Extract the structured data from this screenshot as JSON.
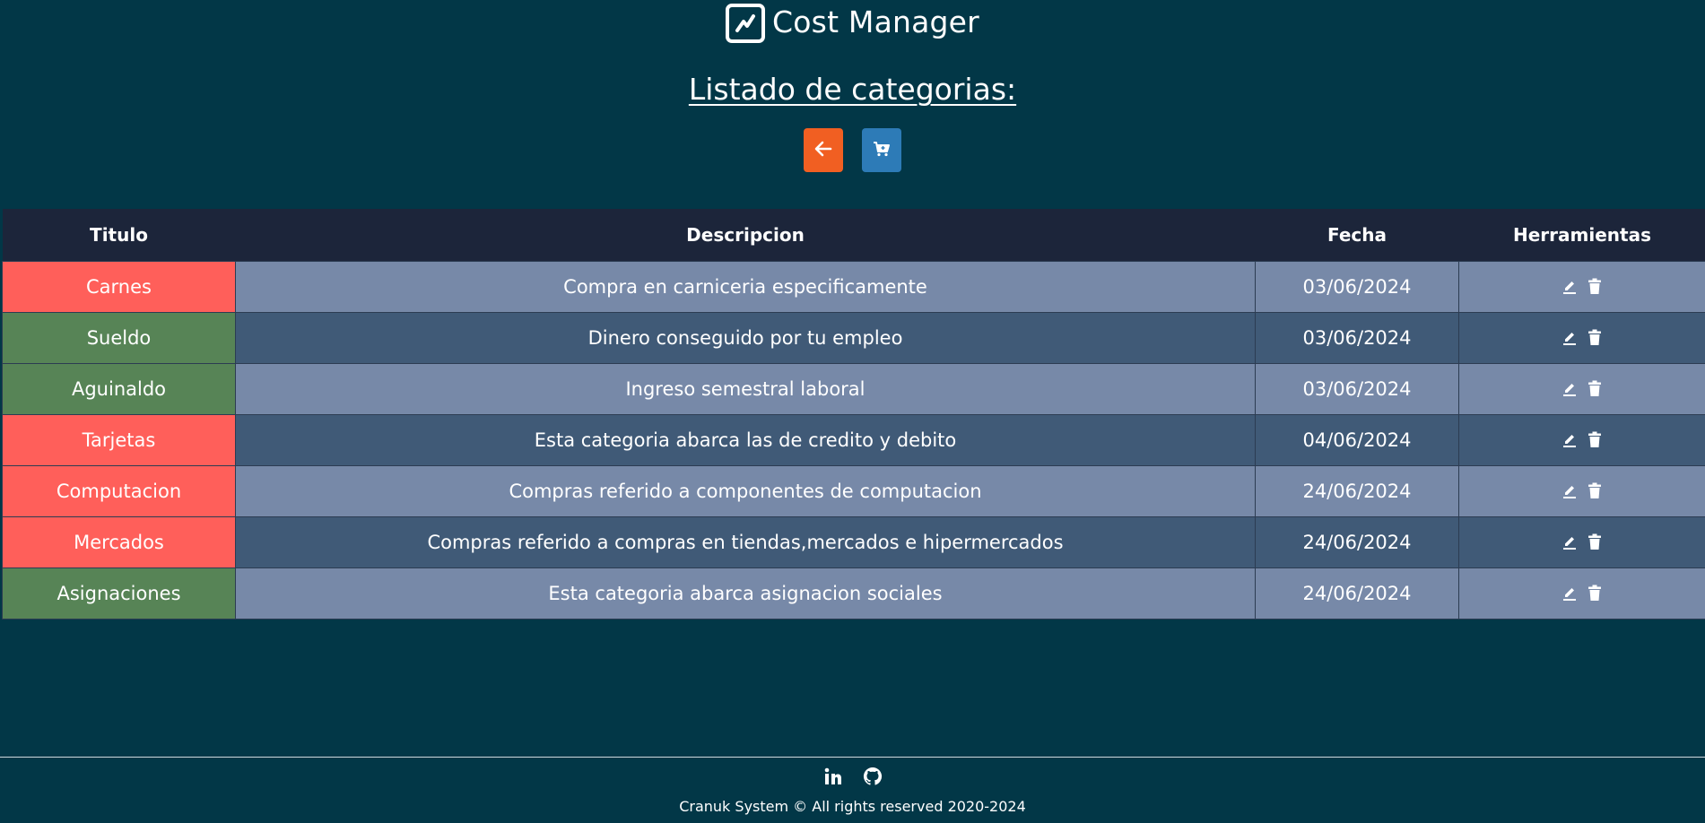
{
  "brand": {
    "title": "Cost Manager",
    "logo_icon": "trend-chart-icon"
  },
  "page": {
    "heading": "Listado de categorias:"
  },
  "actions": {
    "back_icon": "arrow-left-icon",
    "back_color": "#f15f22",
    "cart_icon": "cart-plus-icon",
    "cart_color": "#2d7bb7"
  },
  "table": {
    "columns": [
      "Titulo",
      "Descripcion",
      "Fecha",
      "Herramientas"
    ],
    "rows": [
      {
        "title": "Carnes",
        "type": "expense",
        "description": "Compra en carniceria especificamente",
        "date": "03/06/2024"
      },
      {
        "title": "Sueldo",
        "type": "income",
        "description": "Dinero conseguido por tu empleo",
        "date": "03/06/2024"
      },
      {
        "title": "Aguinaldo",
        "type": "income",
        "description": "Ingreso semestral laboral",
        "date": "03/06/2024"
      },
      {
        "title": "Tarjetas",
        "type": "expense",
        "description": "Esta categoria abarca las de credito y debito",
        "date": "04/06/2024"
      },
      {
        "title": "Computacion",
        "type": "expense",
        "description": "Compras referido a componentes de computacion",
        "date": "24/06/2024"
      },
      {
        "title": "Mercados",
        "type": "expense",
        "description": "Compras referido a compras en tiendas,mercados e hipermercados",
        "date": "24/06/2024"
      },
      {
        "title": "Asignaciones",
        "type": "income",
        "description": "Esta categoria abarca asignacion sociales",
        "date": "24/06/2024"
      }
    ],
    "tool_icons": [
      "edit-icon",
      "trash-icon"
    ],
    "colors": {
      "expense": "#ff5f5a",
      "income": "#578456",
      "header": "#1c253a",
      "row_light": "#7789a8",
      "row_dark": "#405a77"
    }
  },
  "footer": {
    "social_icons": [
      "linkedin-icon",
      "github-icon"
    ],
    "copyright": "Cranuk System © All rights reserved 2020-2024"
  }
}
